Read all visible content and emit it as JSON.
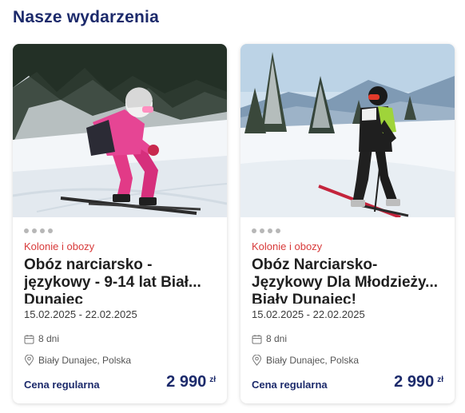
{
  "section": {
    "title": "Nasze wydarzenia"
  },
  "cards": [
    {
      "category": "Kolonie i obozy",
      "title_lines": [
        "Obóz narciarsko -",
        "językowy - 9-14 lat Biał...",
        "Dunajec"
      ],
      "dates": "15.02.2025 - 22.02.2025",
      "duration": "8 dni",
      "location": "Biały Dunajec, Polska",
      "price_label": "Cena regularna",
      "price": "2 990",
      "currency": "zł",
      "image_icon": "skier-photo"
    },
    {
      "category": "Kolonie i obozy",
      "title_lines": [
        "Obóz Narciarsko-",
        "Językowy Dla Młodzieży...",
        "Biały Dunajec!"
      ],
      "dates": "15.02.2025 - 22.02.2025",
      "duration": "8 dni",
      "location": "Biały Dunajec, Polska",
      "price_label": "Cena regularna",
      "price": "2 990",
      "currency": "zł",
      "image_icon": "skier-photo"
    }
  ],
  "colors": {
    "brand": "#1c2a6b",
    "category": "#d83a3a"
  }
}
